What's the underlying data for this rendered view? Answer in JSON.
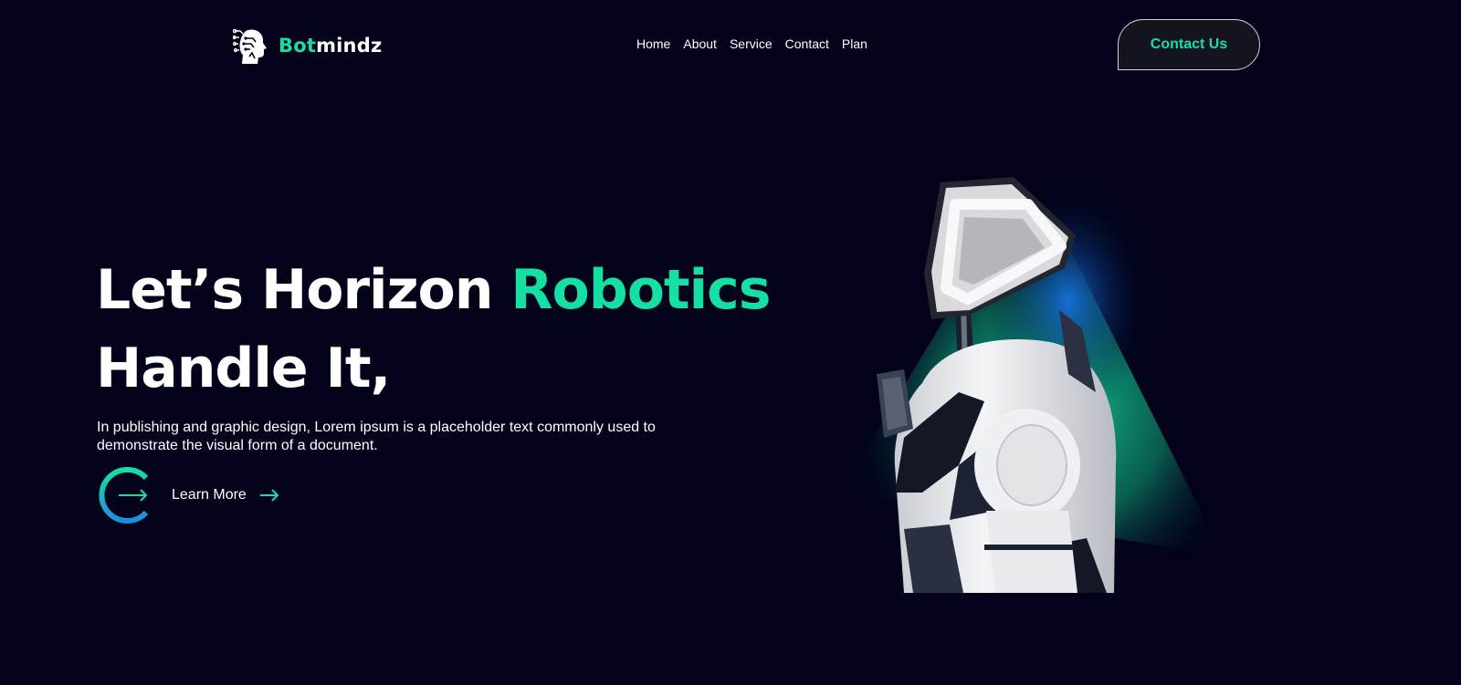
{
  "brand": {
    "name_accent": "Bot",
    "name_rest": "mindz",
    "logo_icon": "robot-head-circuit-icon"
  },
  "nav": {
    "items": [
      "Home",
      "About",
      "Service",
      "Contact",
      "Plan"
    ]
  },
  "header": {
    "cta_label": "Contact Us"
  },
  "hero": {
    "title_line1": "Let’s Horizon ",
    "title_highlight": "Robotics",
    "title_line2": "Handle It,",
    "description": "In publishing and graphic design, Lorem ipsum is a placeholder text commonly used to demonstrate the visual form of a document.",
    "learn_more_label": "Learn More",
    "learn_more_icon": "arrow-right-icon"
  },
  "colors": {
    "background": "#02021a",
    "accent": "#14e0a4",
    "text": "#ffffff"
  }
}
